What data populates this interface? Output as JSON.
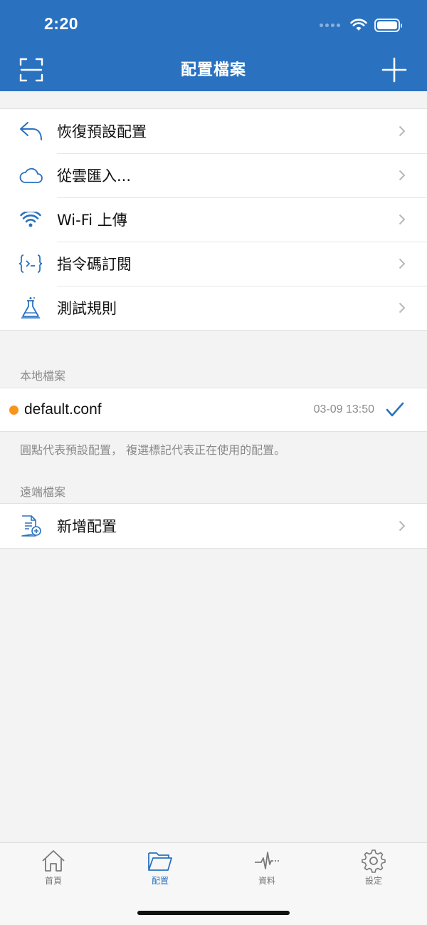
{
  "status_bar": {
    "time": "2:20"
  },
  "nav": {
    "title": "配置檔案"
  },
  "actions": [
    {
      "label": "恢復預設配置",
      "icon": "undo-arrow-icon"
    },
    {
      "label": "從雲匯入...",
      "icon": "cloud-icon"
    },
    {
      "label": "Wi-Fi 上傳",
      "icon": "wifi-icon"
    },
    {
      "label": "指令碼訂閱",
      "icon": "code-braces-icon"
    },
    {
      "label": "測試規則",
      "icon": "flask-icon"
    }
  ],
  "local": {
    "header": "本地檔案",
    "file": {
      "name": "default.conf",
      "time": "03-09 13:50"
    },
    "note": "圓點代表預設配置， 複選標記代表正在使用的配置。"
  },
  "remote": {
    "header": "遠端檔案",
    "add_label": "新增配置"
  },
  "tabs": [
    {
      "label": "首頁",
      "icon": "home-icon"
    },
    {
      "label": "配置",
      "icon": "folder-icon"
    },
    {
      "label": "資料",
      "icon": "pulse-icon"
    },
    {
      "label": "設定",
      "icon": "gear-icon"
    }
  ],
  "colors": {
    "accent": "#2a72c0",
    "default_dot": "#f7941d",
    "background": "#f3f3f3"
  }
}
